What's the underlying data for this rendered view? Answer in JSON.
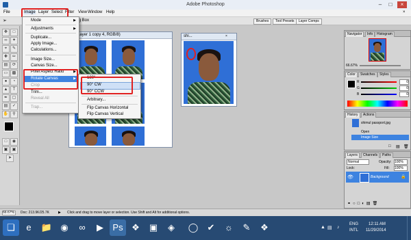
{
  "window": {
    "title": "Adobe Photoshop"
  },
  "menubar": {
    "items": [
      "File",
      "Image",
      "Layer",
      "Select",
      "Filter",
      "View",
      "Window",
      "Help"
    ]
  },
  "optionsbar": {
    "partial_label": "ing Box",
    "tabs": [
      "Brushes",
      "Tool Presets",
      "Layer Comps"
    ]
  },
  "doc_main": {
    "title": "% (Layer 1 copy 4, RGB/8)"
  },
  "doc_second": {
    "title": "shi..."
  },
  "image_menu": {
    "items": [
      {
        "label": "Mode",
        "disabled": false,
        "submenu": true
      },
      {
        "label": "Adjustments",
        "disabled": false,
        "submenu": true
      },
      {
        "label": "Duplicate...",
        "disabled": false
      },
      {
        "label": "Apply Image...",
        "disabled": false
      },
      {
        "label": "Calculations...",
        "disabled": false
      },
      {
        "label": "Image Size...",
        "disabled": false
      },
      {
        "label": "Canvas Size...",
        "disabled": false
      },
      {
        "label": "Pixel Aspect Ratio",
        "disabled": false,
        "submenu": true
      },
      {
        "label": "Rotate Canvas",
        "disabled": false,
        "submenu": true,
        "highlighted": true
      },
      {
        "label": "Crop",
        "disabled": true
      },
      {
        "label": "Trim...",
        "disabled": false
      },
      {
        "label": "Reveal All",
        "disabled": true
      },
      {
        "label": "Trap...",
        "disabled": true
      }
    ]
  },
  "rotate_submenu": {
    "items": [
      "180°",
      "90° CW",
      "90° CCW",
      "Arbitrary...",
      "Flip Canvas Horizontal",
      "Flip Canvas Vertical"
    ],
    "highlighted": "90° CW"
  },
  "navigator": {
    "tabs": [
      "Navigator",
      "Info",
      "Histogram"
    ],
    "zoom": "66.67%"
  },
  "color_panel": {
    "tabs": [
      "Color",
      "Swatches",
      "Styles"
    ],
    "values": [
      "0",
      "0",
      "0"
    ],
    "labels": [
      "R",
      "G",
      "B"
    ]
  },
  "history_panel": {
    "tabs": [
      "History",
      "Actions"
    ],
    "snapshot": "shimul passport.jpg",
    "states": [
      "Open",
      "Image Size"
    ],
    "active": "Image Size"
  },
  "layers_panel": {
    "tabs": [
      "Layers",
      "Channels",
      "Paths"
    ],
    "blend_mode": "Normal",
    "opacity_label": "Opacity:",
    "opacity": "100%",
    "lock_label": "Lock:",
    "fill_label": "Fill:",
    "fill": "100%",
    "layer_name": "Background"
  },
  "statusbar": {
    "zoom": "66.67%",
    "doc": "Doc: 213.9K/25.7K",
    "hint": "Click and drag to move layer or selection. Use Shift and Alt for additional options."
  },
  "taskbar": {
    "lang": "ENG",
    "region": "INTL",
    "time": "12:11 AM",
    "date": "11/29/2014"
  },
  "colors": {
    "accent": "#e02020",
    "photo_bg": "#2f6fd6",
    "highlight": "#3d83e0"
  }
}
